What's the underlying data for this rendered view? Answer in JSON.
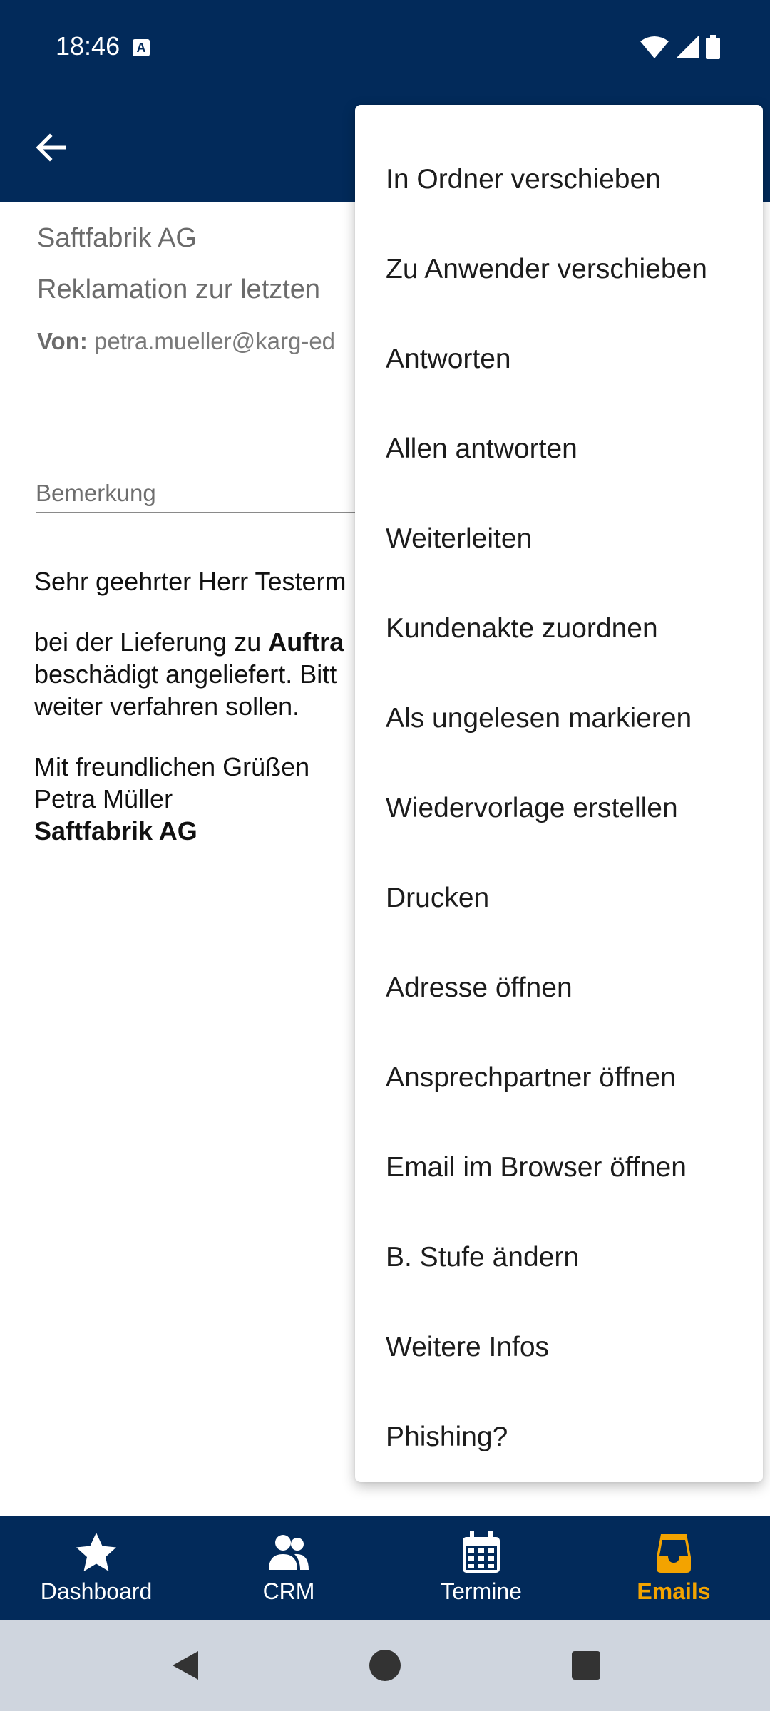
{
  "status_bar": {
    "time": "18:46",
    "keyboard_badge": "A"
  },
  "email": {
    "company": "Saftfabrik AG",
    "subject": "Reklamation zur letzten",
    "from_label": "Von:",
    "from_value": "petra.mueller@karg-ed",
    "remark_placeholder": "Bemerkung",
    "body": {
      "greeting": "Sehr geehrter Herr Testerm",
      "line1_prefix": "bei der Lieferung zu ",
      "line1_bold": "Auftra",
      "line2": "beschädigt angeliefert. Bitt",
      "line3": "weiter verfahren sollen.",
      "closing": "Mit freundlichen Grüßen",
      "signature_name": "Petra Müller",
      "signature_company": "Saftfabrik AG"
    }
  },
  "menu": {
    "items": [
      "In Ordner verschieben",
      "Zu Anwender verschieben",
      "Antworten",
      "Allen antworten",
      "Weiterleiten",
      "Kundenakte zuordnen",
      "Als ungelesen markieren",
      "Wiedervorlage erstellen",
      "Drucken",
      "Adresse öffnen",
      "Ansprechpartner öffnen",
      "Email im Browser öffnen",
      "B. Stufe ändern",
      "Weitere Infos",
      "Phishing?"
    ]
  },
  "bottom_nav": {
    "items": [
      {
        "label": "Dashboard",
        "icon": "star-icon"
      },
      {
        "label": "CRM",
        "icon": "people-icon"
      },
      {
        "label": "Termine",
        "icon": "calendar-icon"
      },
      {
        "label": "Emails",
        "icon": "inbox-icon",
        "active": true
      }
    ]
  },
  "colors": {
    "primary": "#022a5a",
    "accent": "#f3a300",
    "system_nav": "#cfd5de"
  }
}
